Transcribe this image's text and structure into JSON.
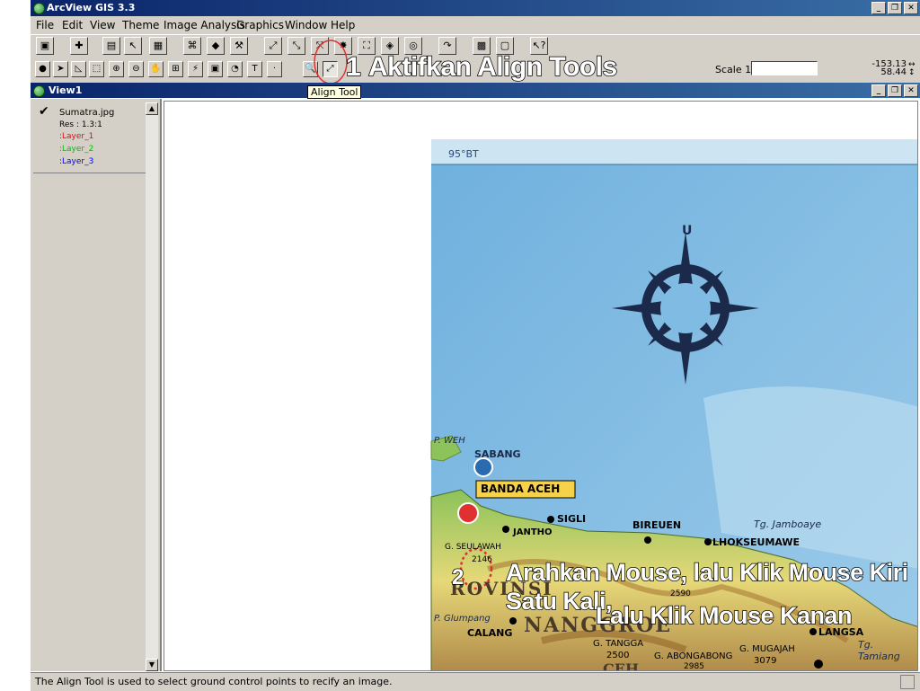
{
  "window": {
    "title": "ArcView GIS 3.3"
  },
  "menu": [
    "File",
    "Edit",
    "View",
    "Theme",
    "Image Analysis",
    "Graphics",
    "Window",
    "Help"
  ],
  "toolbar": {
    "scale_label": "Scale 1:",
    "scale_value": "",
    "coord_x": "-153.13",
    "coord_y": "58.44",
    "text_tool_label": "T",
    "tooltip": "Align Tool"
  },
  "view": {
    "title": "View1"
  },
  "toc": {
    "theme_name": "Sumatra.jpg",
    "resolution": "Res : 1.3:1",
    "layers": [
      {
        "label": ":Layer_1",
        "color": "#ff0000"
      },
      {
        "label": ":Layer_2",
        "color": "#00c000"
      },
      {
        "label": ":Layer_3",
        "color": "#0000ff"
      }
    ]
  },
  "annotations": {
    "step1_number": "1",
    "step1_text": "Aktifkan Align Tools",
    "step2_number": "2",
    "step2_line1": "Arahkan Mouse, lalu Klik Mouse Kiri Satu Kali,",
    "step2_line2": "Lalu Klik Mouse Kanan"
  },
  "map": {
    "longitude_label": "95°BT",
    "north_label": "U",
    "places": {
      "p_weh": "P. WEH",
      "sabang": "SABANG",
      "banda_aceh": "BANDA ACEH",
      "sigli": "SIGLI",
      "bireuen": "BIREUEN",
      "tg_jamboaye": "Tg. Jamboaye",
      "lhokseumawe": "LHOKSEUMAWE",
      "jantho": "JANTHO",
      "g_seulawah": "G. SEULAWAH",
      "g_glumpang": "P. Glumpang",
      "calang": "CALANG",
      "nanggroe": "NANGGROE",
      "provinsi": "ROVINSI",
      "g_tangga": "G. TANGGA",
      "tangga_h": "2500",
      "g_abongabong": "G. ABONGABONG",
      "abongabong_h": "2985",
      "g_mugajah": "G. MUGAJAH",
      "mugajah_h": "3079",
      "h2590": "2590",
      "langsa": "LANGSA",
      "tg_tamiang": "Tg. Tamiang",
      "h2146": "2146",
      "aceh_fragment": "CEH"
    }
  },
  "status": {
    "text": "The Align Tool is used to select ground control points to recify an image."
  },
  "colors": {
    "title_blue": "#0a246a",
    "chrome": "#d4d0c8",
    "sea": "#8ec3e6",
    "land_green": "#8cc35a",
    "land_yellow": "#e6d878",
    "tooltip_bg": "#ffffe1"
  },
  "icons": [
    "app-globe-icon",
    "save-icon",
    "add-theme-icon",
    "theme-properties-icon",
    "edit-legend-icon",
    "open-table-icon",
    "query-builder-icon",
    "locate-address-icon",
    "hot-link-icon",
    "zoom-full-extent-icon",
    "zoom-to-themes-icon",
    "zoom-selected-icon",
    "zoom-in-fixed-icon",
    "zoom-out-fixed-icon",
    "zoom-previous-icon",
    "select-by-theme-icon",
    "clear-selected-icon",
    "help-icon",
    "identify-icon",
    "pointer-icon",
    "vertex-edit-icon",
    "select-feature-icon",
    "zoom-in-icon",
    "zoom-out-icon",
    "pan-icon",
    "measure-icon",
    "hotlink-tool-icon",
    "area-of-interest-icon",
    "label-icon",
    "text-tool-icon",
    "draw-point-icon",
    "link-tool-icon",
    "align-tool-icon",
    "checkmark-icon",
    "compass-rose-icon"
  ]
}
